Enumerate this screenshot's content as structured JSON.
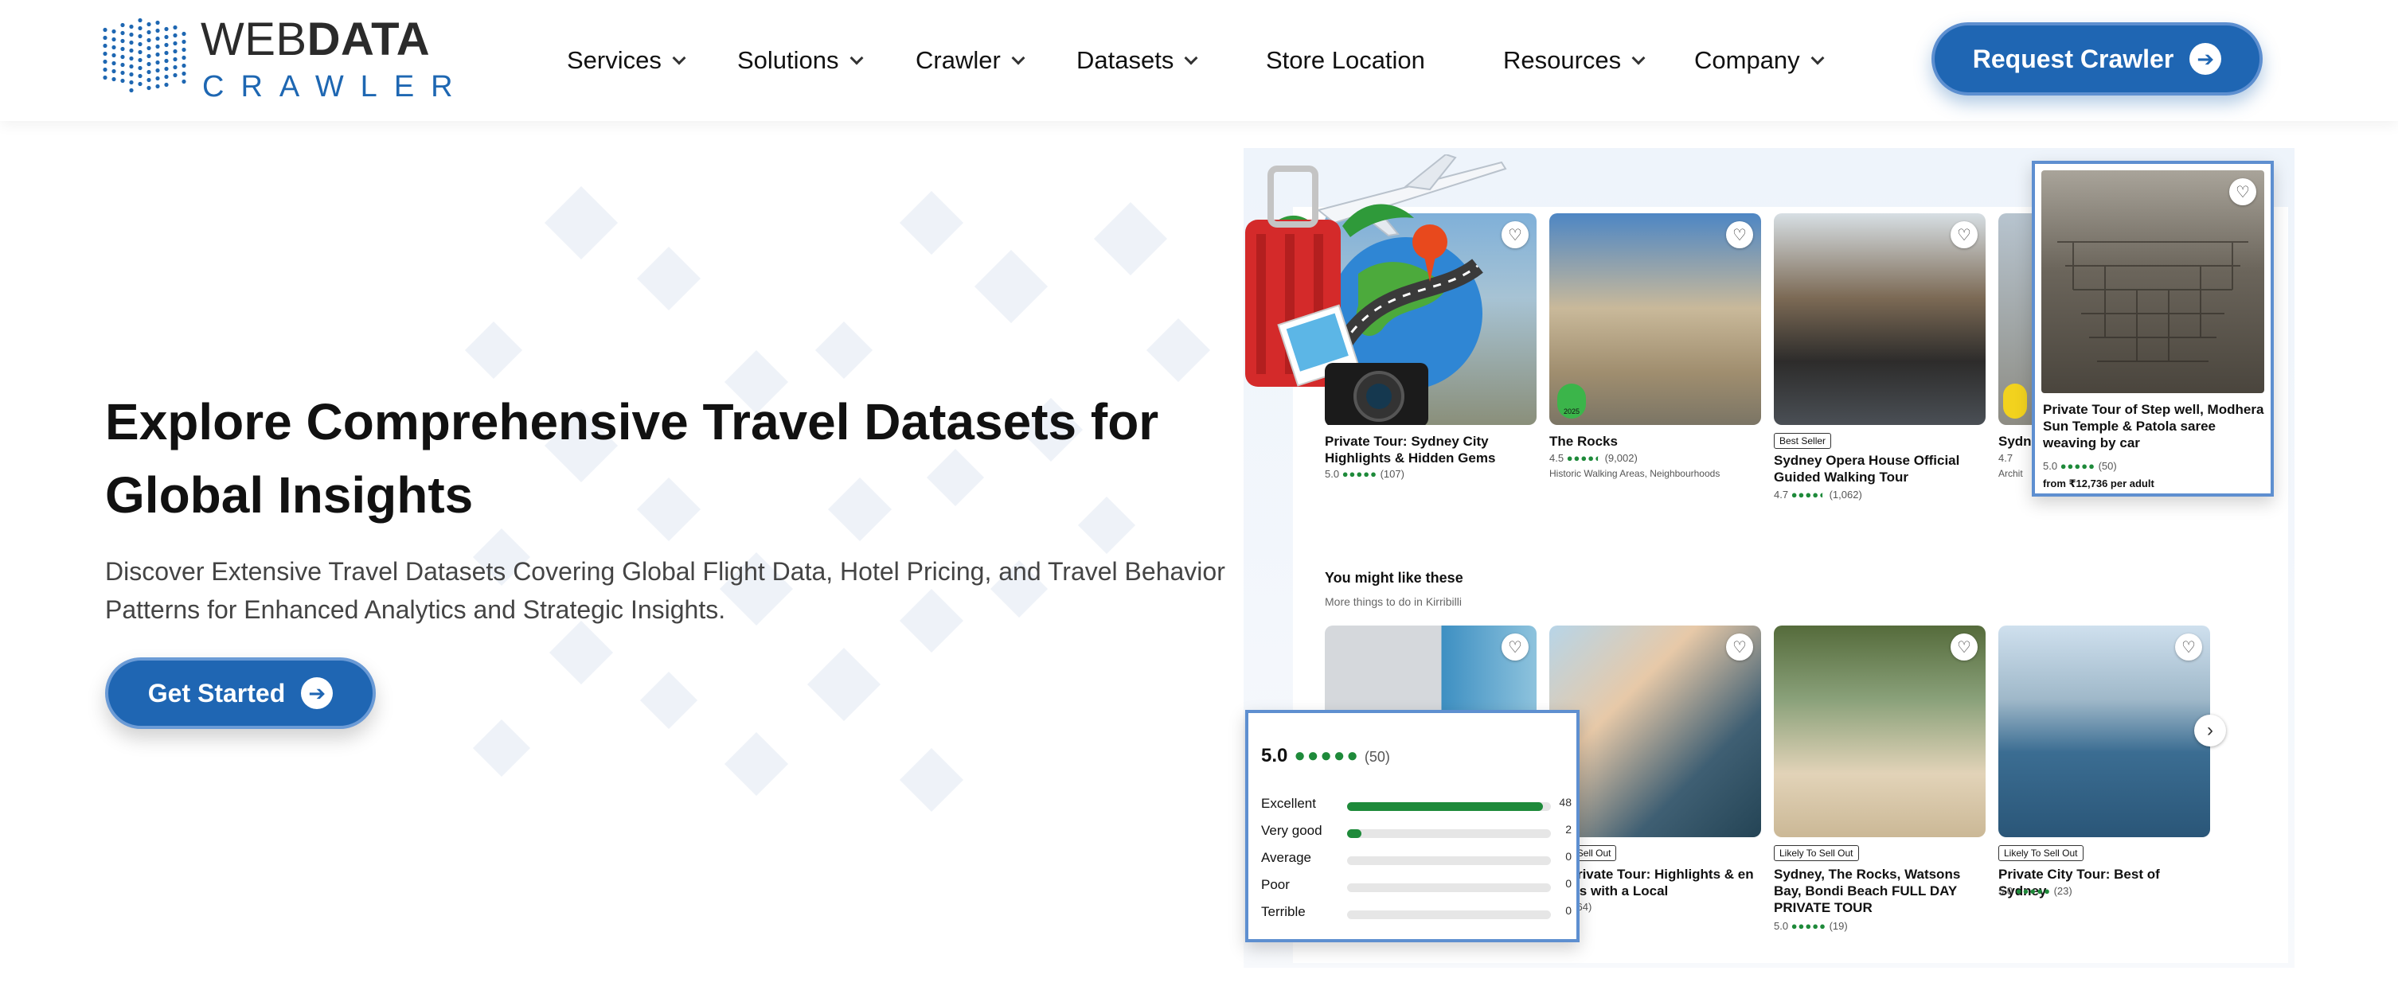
{
  "logo": {
    "top_light": "WEB",
    "top_bold": "DATA",
    "bottom": "CRAWLER"
  },
  "nav": {
    "items": [
      {
        "label": "Services",
        "has_dropdown": true
      },
      {
        "label": "Solutions",
        "has_dropdown": true
      },
      {
        "label": "Crawler",
        "has_dropdown": true
      },
      {
        "label": "Datasets",
        "has_dropdown": true
      },
      {
        "label": "Store Location",
        "has_dropdown": false
      },
      {
        "label": "Resources",
        "has_dropdown": true
      },
      {
        "label": "Company",
        "has_dropdown": true
      }
    ],
    "cta_label": "Request Crawler"
  },
  "hero": {
    "title": "Explore Comprehensive Travel Datasets for Global Insights",
    "subtitle": "Discover Extensive Travel Datasets Covering Global Flight Data, Hotel Pricing, and Travel Behavior Patterns for Enhanced Analytics and Strategic Insights.",
    "cta_label": "Get Started"
  },
  "collage": {
    "top_cards": [
      {
        "title": "Private Tour: Sydney City Highlights & Hidden Gems",
        "rating": "5.0",
        "reviews": "(107)",
        "tag": "",
        "meta": ""
      },
      {
        "title": "The Rocks",
        "rating": "4.5",
        "reviews": "(9,002)",
        "tag": "",
        "meta": "Historic Walking Areas, Neighbourhoods"
      },
      {
        "title": "Sydney Opera House Official Guided Walking Tour",
        "rating": "4.7",
        "reviews": "(1,062)",
        "tag": "Best Seller",
        "meta": ""
      },
      {
        "title": "Sydn",
        "rating": "4.7",
        "reviews": "",
        "tag": "",
        "meta": "Archit"
      }
    ],
    "section_title": "You might like these",
    "section_subtitle": "More things to do in Kirribilli",
    "bottom_cards": [
      {
        "title": "",
        "rating": "",
        "reviews": "",
        "tag": ""
      },
      {
        "title": "ey Private Tour: Highlights & en Gems with a Local",
        "rating": "",
        "reviews": "(64)",
        "tag": "ly To Sell Out"
      },
      {
        "title": "Sydney, The Rocks, Watsons Bay, Bondi Beach FULL DAY PRIVATE TOUR",
        "rating": "5.0",
        "reviews": "(19)",
        "tag": "Likely To Sell Out"
      },
      {
        "title": "Private City Tour: Best of Sydney",
        "rating": "5.0",
        "reviews": "(23)",
        "tag": "Likely To Sell Out"
      }
    ],
    "featured": {
      "title": "Private Tour of Step well, Modhera Sun Temple & Patola saree weaving by car",
      "rating": "5.0",
      "reviews": "(50)",
      "price": "from ₹12,736 per adult"
    },
    "ratings_panel": {
      "score": "5.0",
      "count": "(50)",
      "rows": [
        {
          "label": "Excellent",
          "count": "48",
          "fraction": 0.96
        },
        {
          "label": "Very good",
          "count": "2",
          "fraction": 0.04
        },
        {
          "label": "Average",
          "count": "0",
          "fraction": 0
        },
        {
          "label": "Poor",
          "count": "0",
          "fraction": 0
        },
        {
          "label": "Terrible",
          "count": "0",
          "fraction": 0
        }
      ]
    },
    "badge_year": "2025"
  },
  "colors": {
    "brand_blue": "#1f66b3",
    "rating_green": "#1e8a3a"
  }
}
